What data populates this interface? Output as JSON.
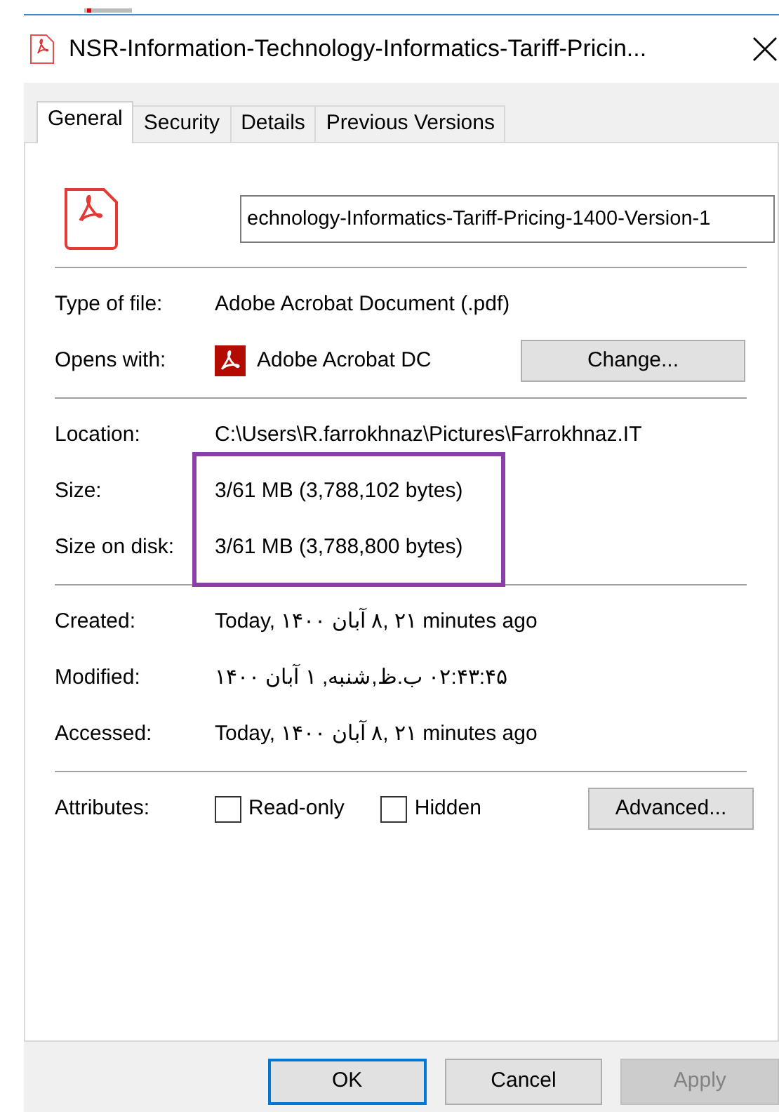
{
  "window": {
    "title": "NSR-Information-Technology-Informatics-Tariff-Pricin..."
  },
  "tabs": [
    {
      "label": "General",
      "selected": true
    },
    {
      "label": "Security",
      "selected": false
    },
    {
      "label": "Details",
      "selected": false
    },
    {
      "label": "Previous Versions",
      "selected": false
    }
  ],
  "file_name": {
    "value": "echnology-Informatics-Tariff-Pricing-1400-Version-1"
  },
  "sections": [
    {
      "rows": [
        {
          "kind": "text",
          "label": "Type of file:",
          "value": "Adobe Acrobat Document (.pdf)",
          "highlighted": false
        },
        {
          "kind": "app",
          "label": "Opens with:",
          "value": "Adobe Acrobat DC",
          "button": "Change...",
          "highlighted": false
        }
      ]
    },
    {
      "rows": [
        {
          "kind": "text",
          "label": "Location:",
          "value": "C:\\Users\\R.farrokhnaz\\Pictures\\Farrokhnaz.IT",
          "highlighted": false
        },
        {
          "kind": "text",
          "label": "Size:",
          "value": "3/61 MB (3,788,102 bytes)",
          "highlighted": true
        },
        {
          "kind": "text",
          "label": "Size on disk:",
          "value": "3/61 MB (3,788,800 bytes)",
          "highlighted": true
        }
      ]
    },
    {
      "rows": [
        {
          "kind": "text",
          "label": "Created:",
          "value": "Today, ۱۴۰۰ آبان‎ ۸, ۲۱ minutes ago",
          "highlighted": false
        },
        {
          "kind": "rtl",
          "label": "Modified:",
          "value": "۰۲:۴۳:۴۵ ب.ظ,شنبه, ۱ آبان ۱۴۰۰",
          "highlighted": false
        },
        {
          "kind": "text",
          "label": "Accessed:",
          "value": "Today, ۱۴۰۰ آبان‎ ۸, ۲۱ minutes ago",
          "highlighted": false
        }
      ]
    },
    {
      "rows": [
        {
          "kind": "attributes",
          "label": "Attributes:",
          "checkboxes": [
            {
              "label": "Read-only",
              "checked": false
            },
            {
              "label": "Hidden",
              "checked": false
            }
          ],
          "button": "Advanced...",
          "highlighted": false
        }
      ]
    }
  ],
  "buttons": [
    {
      "label": "OK",
      "kind": "default",
      "disabled": false
    },
    {
      "label": "Cancel",
      "kind": "normal",
      "disabled": false
    },
    {
      "label": "Apply",
      "kind": "normal",
      "disabled": true
    }
  ]
}
